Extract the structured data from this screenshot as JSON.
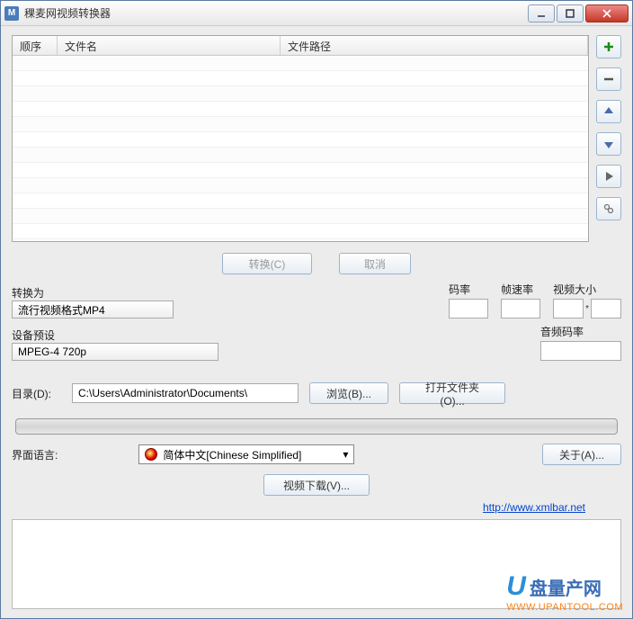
{
  "window": {
    "title": "稞麦网视频转换器"
  },
  "table": {
    "headers": {
      "order": "顺序",
      "filename": "文件名",
      "filepath": "文件路径"
    }
  },
  "buttons": {
    "convert": "转换(C)",
    "cancel": "取消",
    "browse": "浏览(B)...",
    "openfolder": "打开文件夹(O)...",
    "about": "关于(A)...",
    "download": "视频下载(V)..."
  },
  "labels": {
    "convert_to": "转换为",
    "device_preset": "设备预设",
    "bitrate": "码率",
    "framerate": "帧速率",
    "video_size": "视频大小",
    "audio_bitrate": "音频码率",
    "directory": "目录(D):",
    "language": "界面语言:"
  },
  "values": {
    "format": "流行视频格式MP4",
    "preset": "MPEG-4 720p",
    "directory": "C:\\Users\\Administrator\\Documents\\",
    "language": "简体中文[Chinese Simplified]",
    "link": "http://www.xmlbar.net"
  },
  "watermark": {
    "brand": "盘量产网",
    "url": "WWW.UPANTOOL.COM"
  }
}
